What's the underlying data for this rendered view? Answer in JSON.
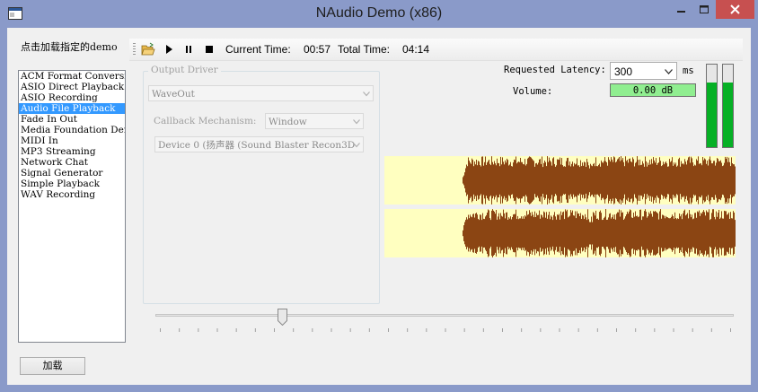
{
  "window": {
    "title": "NAudio Demo (x86)"
  },
  "sidebar": {
    "label": "点击加载指定的demo",
    "items": [
      {
        "label": "ACM Format Conversion"
      },
      {
        "label": "ASIO Direct Playback"
      },
      {
        "label": "ASIO Recording"
      },
      {
        "label": "Audio File Playback",
        "selected": true
      },
      {
        "label": "Fade In Out"
      },
      {
        "label": "Media Foundation Demo"
      },
      {
        "label": "MIDI In"
      },
      {
        "label": "MP3 Streaming"
      },
      {
        "label": "Network Chat"
      },
      {
        "label": "Signal Generator"
      },
      {
        "label": "Simple Playback"
      },
      {
        "label": "WAV Recording"
      }
    ],
    "load_button": "加载"
  },
  "toolbar": {
    "icons": [
      "open-folder-icon",
      "play-icon",
      "pause-icon",
      "stop-icon"
    ],
    "current_time_label": "Current Time:",
    "current_time": "00:57",
    "total_time_label": "Total Time:",
    "total_time": "04:14"
  },
  "output_driver": {
    "group_title": "Output Driver",
    "driver_value": "WaveOut",
    "callback_label": "Callback Mechanism:",
    "callback_value": "Window",
    "device_value": "Device 0 (扬声器 (Sound Blaster Recon3D"
  },
  "settings": {
    "latency_label": "Requested Latency:",
    "latency_value": "300",
    "latency_unit": "ms",
    "volume_label": "Volume:",
    "volume_value": "0.00 dB"
  },
  "meters": {
    "left_level": 0.78,
    "right_level": 0.78,
    "color": "#06b025"
  },
  "waveform": {
    "background": "#ffffc0",
    "color": "#8b4513"
  },
  "position_slider": {
    "position_fraction": 0.22
  }
}
